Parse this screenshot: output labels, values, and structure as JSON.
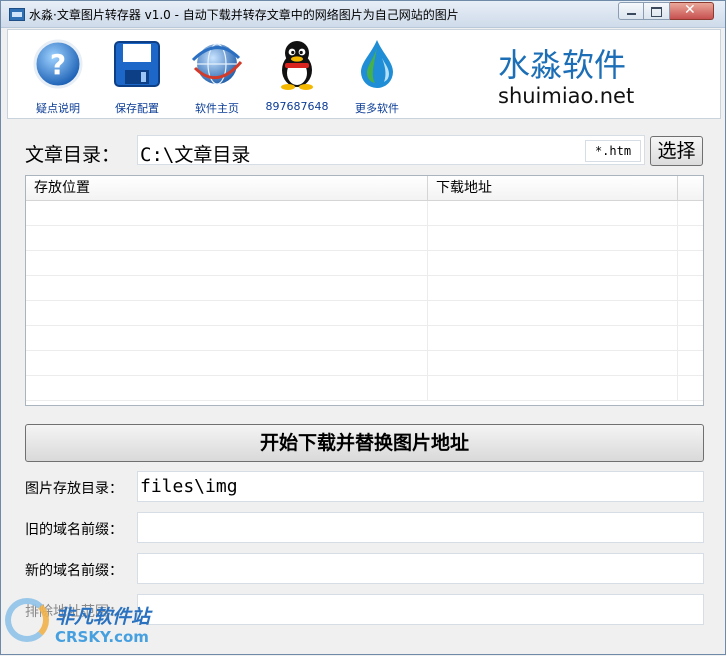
{
  "window": {
    "title": "水淼·文章图片转存器 v1.0 - 自动下载并转存文章中的网络图片为自己网站的图片"
  },
  "toolbar": {
    "items": [
      {
        "label": "疑点说明",
        "icon": "help-icon"
      },
      {
        "label": "保存配置",
        "icon": "save-icon"
      },
      {
        "label": "软件主页",
        "icon": "globe-icon"
      },
      {
        "label": "897687648",
        "icon": "qq-icon"
      },
      {
        "label": "更多软件",
        "icon": "water-drop-icon"
      }
    ],
    "brand_cn": "水淼软件",
    "brand_en": "shuimiao.net"
  },
  "article_dir": {
    "label": "文章目录：",
    "value": "C:\\文章目录",
    "ext": "*.htm",
    "choose_label": "选择"
  },
  "list": {
    "columns": [
      "存放位置",
      "下载地址",
      ""
    ],
    "rows": [
      [],
      [],
      [],
      [],
      [],
      [],
      [],
      []
    ]
  },
  "start_button": "开始下载并替换图片地址",
  "form": {
    "img_dir_label": "图片存放目录：",
    "img_dir_value": "files\\img",
    "old_prefix_label": "旧的域名前缀：",
    "old_prefix_value": "",
    "new_prefix_label": "新的域名前缀：",
    "new_prefix_value": "",
    "exclude_label": "排除地址范围：",
    "exclude_value": ""
  },
  "watermark": {
    "cn": "非凡软件站",
    "en": "CRSKY.com"
  },
  "colors": {
    "link_blue": "#0b3c96",
    "brand_blue": "#1c6fb6"
  }
}
